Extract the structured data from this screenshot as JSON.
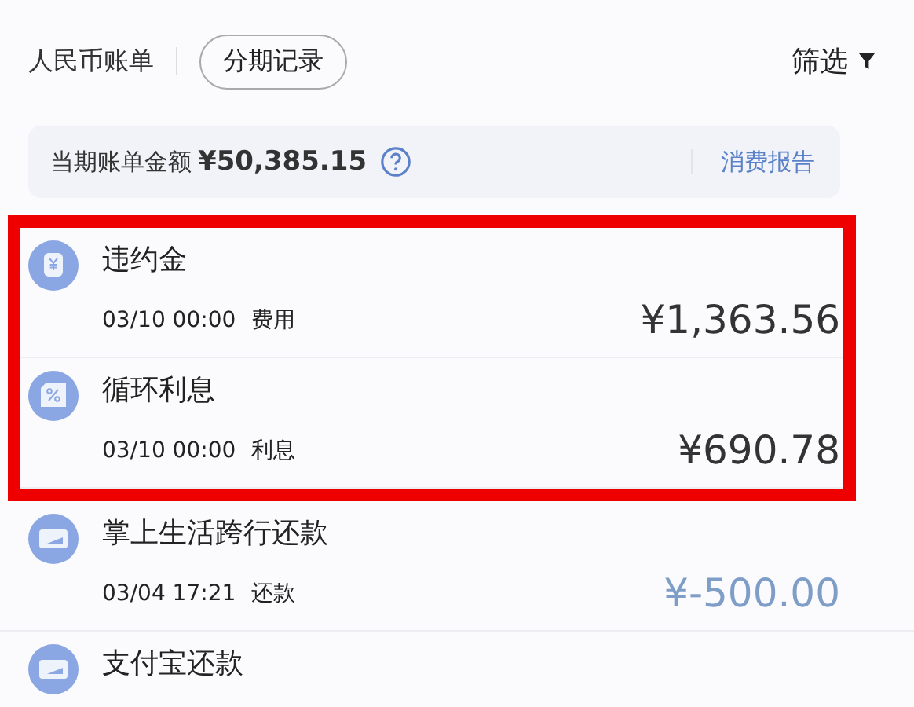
{
  "header": {
    "tabs": [
      {
        "label": "人民币账单",
        "selected": true
      },
      {
        "label": "分期记录",
        "selected": false
      }
    ],
    "filter": {
      "label": "筛选"
    }
  },
  "summary": {
    "label": "当期账单金额",
    "amount": "¥50,385.15",
    "link": "消费报告"
  },
  "transactions": [
    {
      "kind": "fee",
      "title": "违约金",
      "time": "03/10 00:00",
      "category": "费用",
      "amount": "¥1,363.56",
      "highlighted": true
    },
    {
      "kind": "interest",
      "title": "循环利息",
      "time": "03/10 00:00",
      "category": "利息",
      "amount": "¥690.78",
      "highlighted": true
    },
    {
      "kind": "repayment",
      "title": "掌上生活跨行还款",
      "time": "03/04 17:21",
      "category": "还款",
      "amount": "¥-500.00",
      "highlighted": false
    },
    {
      "kind": "repayment",
      "title": "支付宝还款",
      "highlighted": false
    }
  ]
}
